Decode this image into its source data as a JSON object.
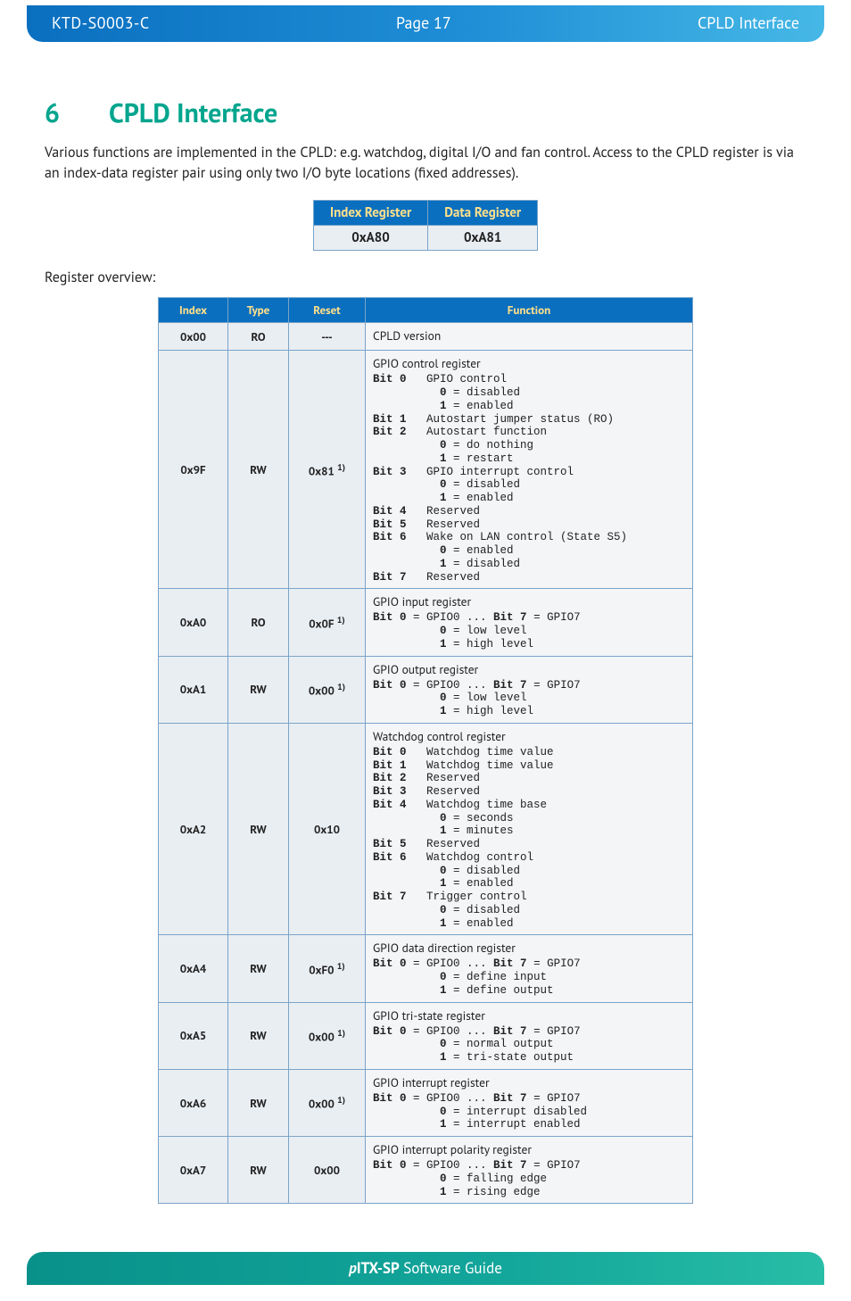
{
  "header": {
    "doc_id": "KTD-S0003-C",
    "page": "Page 17",
    "section": "CPLD Interface"
  },
  "heading": {
    "number": "6",
    "title": "CPLD Interface"
  },
  "intro": "Various functions are implemented in the CPLD: e.g. watchdog, digital I/O and fan control. Access to the CPLD register is via an index-data register pair using only two I/O byte locations (fixed addresses).",
  "regpair": {
    "headers": [
      "Index Register",
      "Data Register"
    ],
    "values": [
      "0xA80",
      "0xA81"
    ]
  },
  "overview_label": "Register overview:",
  "table": {
    "headers": [
      "Index",
      "Type",
      "Reset",
      "Function"
    ],
    "rows": [
      {
        "index": "0x00",
        "type": "RO",
        "reset": "---",
        "reset_note": "",
        "func_title": "CPLD version",
        "func_body": ""
      },
      {
        "index": "0x9F",
        "type": "RW",
        "reset": "0x81",
        "reset_note": "1)",
        "func_title": "GPIO control register",
        "func_body": "Bit 0   GPIO control\n          0 = disabled\n          1 = enabled\nBit 1   Autostart jumper status (RO)\nBit 2   Autostart function\n          0 = do nothing\n          1 = restart\nBit 3   GPIO interrupt control\n          0 = disabled\n          1 = enabled\nBit 4   Reserved\nBit 5   Reserved\nBit 6   Wake on LAN control (State S5)\n          0 = enabled\n          1 = disabled\nBit 7   Reserved"
      },
      {
        "index": "0xA0",
        "type": "RO",
        "reset": "0x0F",
        "reset_note": "1)",
        "func_title": "GPIO input register",
        "func_body": "Bit 0 = GPIO0 ... Bit 7 = GPIO7\n          0 = low level\n          1 = high level"
      },
      {
        "index": "0xA1",
        "type": "RW",
        "reset": "0x00",
        "reset_note": "1)",
        "func_title": "GPIO output register",
        "func_body": "Bit 0 = GPIO0 ... Bit 7 = GPIO7\n          0 = low level\n          1 = high level"
      },
      {
        "index": "0xA2",
        "type": "RW",
        "reset": "0x10",
        "reset_note": "",
        "func_title": "Watchdog control register",
        "func_body": "Bit 0   Watchdog time value\nBit 1   Watchdog time value\nBit 2   Reserved\nBit 3   Reserved\nBit 4   Watchdog time base\n          0 = seconds\n          1 = minutes\nBit 5   Reserved\nBit 6   Watchdog control\n          0 = disabled\n          1 = enabled\nBit 7   Trigger control\n          0 = disabled\n          1 = enabled"
      },
      {
        "index": "0xA4",
        "type": "RW",
        "reset": "0xF0",
        "reset_note": "1)",
        "func_title": "GPIO data direction register",
        "func_body": "Bit 0 = GPIO0 ... Bit 7 = GPIO7\n          0 = define input\n          1 = define output"
      },
      {
        "index": "0xA5",
        "type": "RW",
        "reset": "0x00",
        "reset_note": "1)",
        "func_title": "GPIO tri-state register",
        "func_body": "Bit 0 = GPIO0 ... Bit 7 = GPIO7\n          0 = normal output\n          1 = tri-state output"
      },
      {
        "index": "0xA6",
        "type": "RW",
        "reset": "0x00",
        "reset_note": "1)",
        "func_title": "GPIO interrupt register",
        "func_body": "Bit 0 = GPIO0 ... Bit 7 = GPIO7\n          0 = interrupt disabled\n          1 = interrupt enabled"
      },
      {
        "index": "0xA7",
        "type": "RW",
        "reset": "0x00",
        "reset_note": "",
        "func_title": "GPIO interrupt polarity register",
        "func_body": "Bit 0 = GPIO0 ... Bit 7 = GPIO7\n          0 = falling edge\n          1 = rising edge"
      }
    ]
  },
  "footer": {
    "prefix_ital": "p",
    "prefix_bold": "ITX-SP",
    "rest": " Software Guide"
  }
}
